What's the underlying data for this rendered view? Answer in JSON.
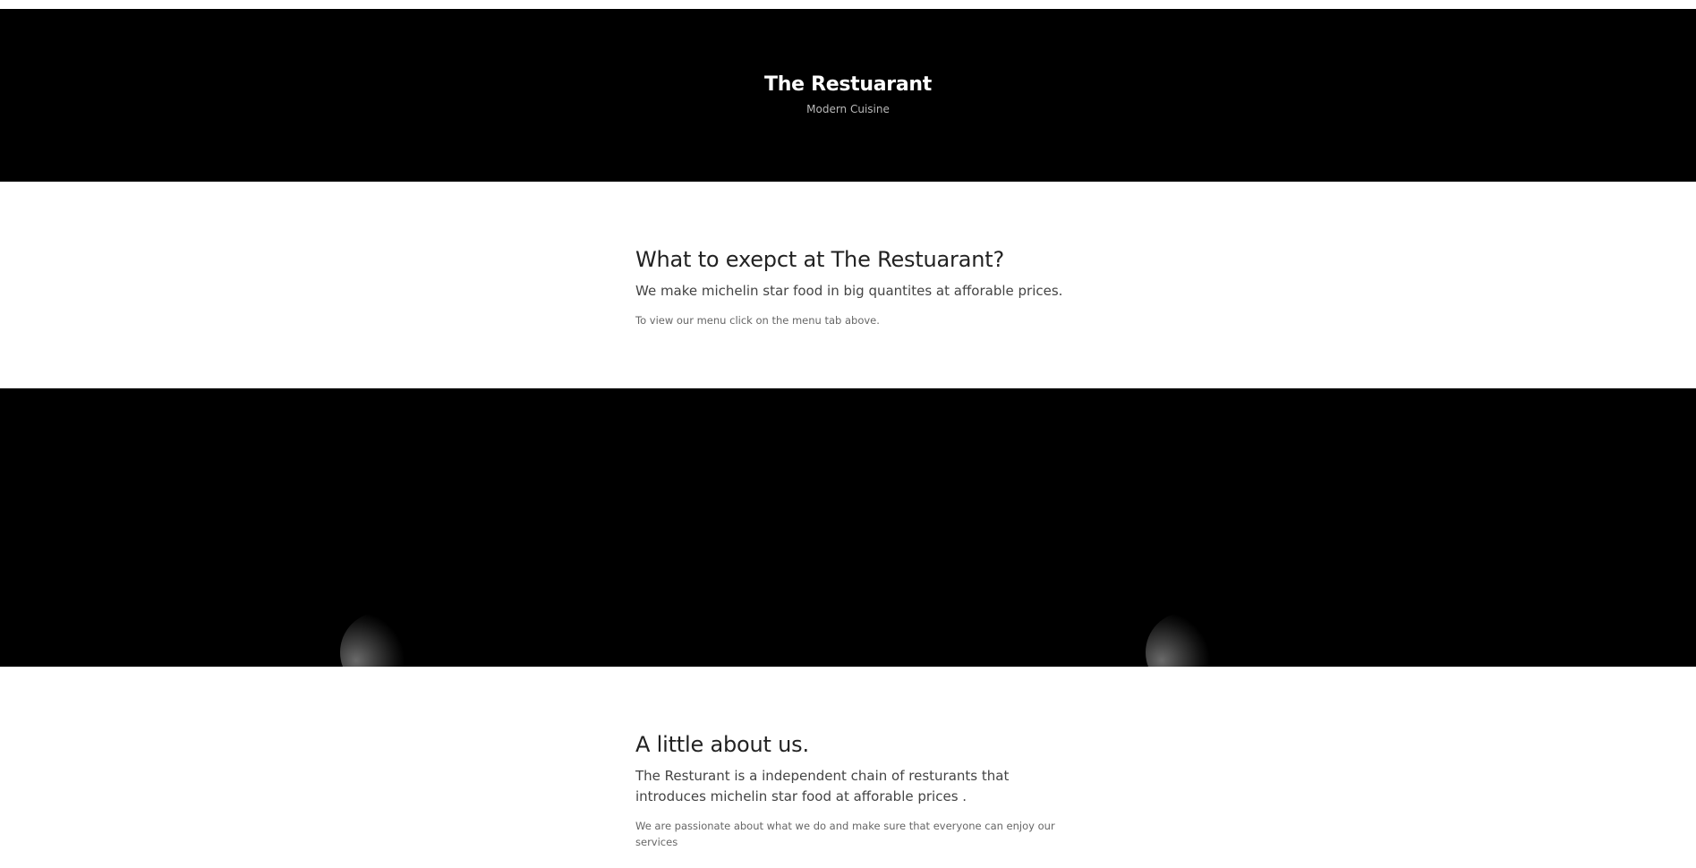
{
  "hero": {
    "title": "The Restuarant",
    "subtitle": "Modern Cuisine"
  },
  "expect_section": {
    "heading": "What to exepct at The Restuarant?",
    "lead": "We make michelin star food in big quantites at afforable prices.",
    "note": "To view our menu click on the menu tab above."
  },
  "about_section": {
    "heading": "A little about us.",
    "lead": "The Resturant is a independent chain of resturants that introduces michelin star food at afforable prices .",
    "note": "We are passionate about what we do and make sure that everyone can enjoy our services"
  },
  "colors": {
    "band": "#000000",
    "background": "#ffffff"
  }
}
